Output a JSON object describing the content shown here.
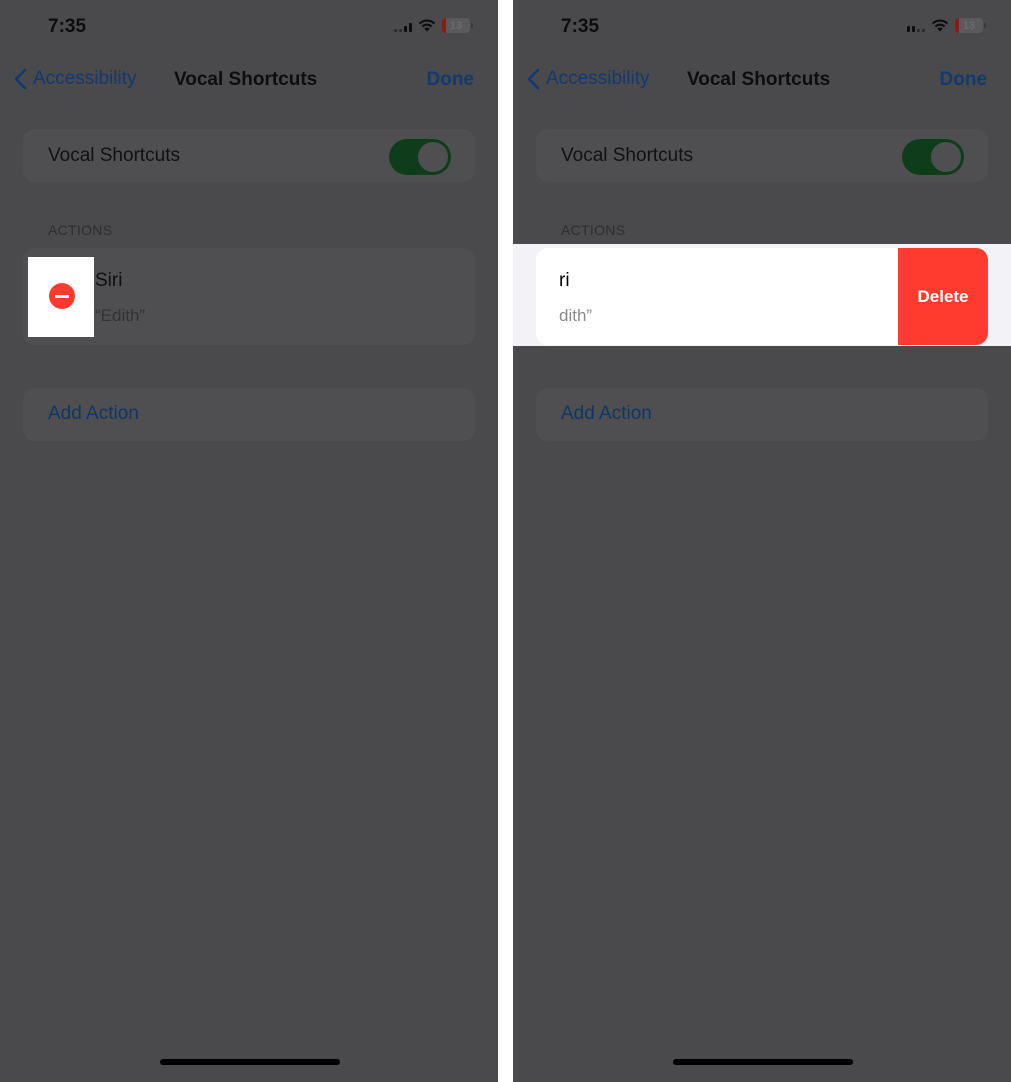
{
  "status_bar": {
    "time": "7:35",
    "battery": "13"
  },
  "nav": {
    "back_label": "Accessibility",
    "title": "Vocal Shortcuts",
    "done_label": "Done"
  },
  "toggle_row": {
    "label": "Vocal Shortcuts",
    "enabled": true
  },
  "actions_section": {
    "header": "ACTIONS",
    "items": [
      {
        "title": "Siri",
        "phrase": "“Edith”"
      }
    ],
    "add_label": "Add Action"
  },
  "swipe_panel": {
    "visible_title": "ri",
    "visible_phrase": "dith”",
    "delete_label": "Delete"
  },
  "colors": {
    "delete_red": "#ff3b30",
    "toggle_green_dimmed": "#0f3d1c",
    "link_blue_dimmed": "#103a70",
    "overlay_background": "#4a4a4c"
  }
}
